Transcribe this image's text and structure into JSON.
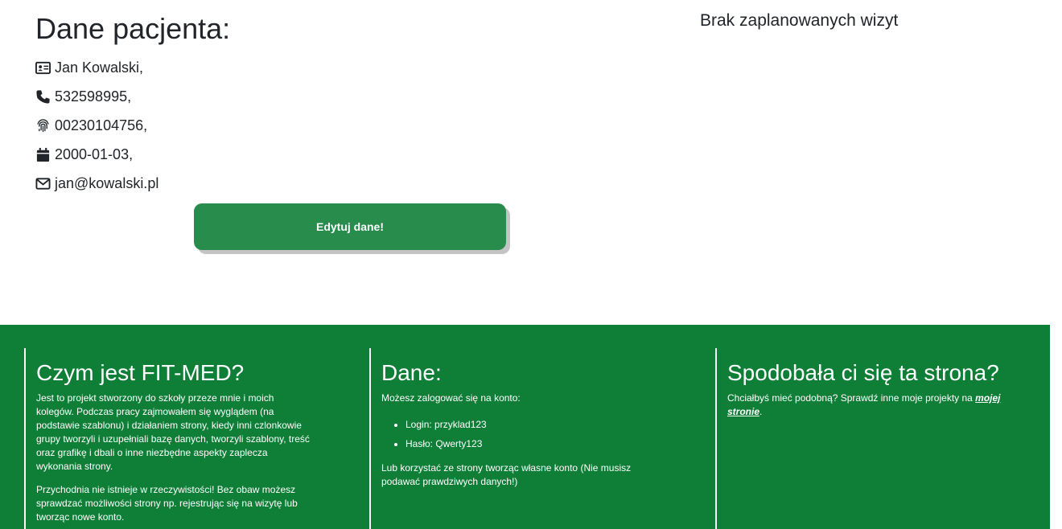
{
  "patient": {
    "heading": "Dane pacjenta:",
    "name": "Jan Kowalski,",
    "phone": "532598995,",
    "pesel": "00230104756,",
    "birth_date": "2000-01-03,",
    "email": "jan@kowalski.pl",
    "edit_button": "Edytuj dane!",
    "icons": [
      "id-card-icon",
      "phone-icon",
      "fingerprint-icon",
      "calendar-icon",
      "envelope-icon"
    ]
  },
  "visits": {
    "empty_text": "Brak zaplanowanych wizyt"
  },
  "footer": {
    "background": "#0f7e37",
    "about": {
      "title": "Czym jest FIT-MED?",
      "p1": "Jest to projekt stworzony do szkoły przeze mnie i moich kolegów. Podczas pracy zajmowałem się wyglądem (na podstawie szablonu) i działaniem strony, kiedy inni czlonkowie grupy tworzyli i uzupełniali bazę danych, tworzyli szablony, treść oraz grafikę i dbali o inne niezbędne aspekty zaplecza wykonania strony.",
      "p2": "Przychodnia nie istnieje w rzeczywistości! Bez obaw możesz sprawdzać możliwości strony np. rejestrując się na wizytę lub tworząc nowe konto."
    },
    "data": {
      "title": "Dane:",
      "intro": "Możesz zalogować się na konto:",
      "login": "Login: przyklad123",
      "password": "Hasło: Qwerty123",
      "note": "Lub korzystać ze strony tworząc własne konto (Nie musisz podawać prawdziwych danych!)"
    },
    "like": {
      "title": "Spodobała ci się ta strona?",
      "text": "Chciałbyś mieć podobną? Sprawdź inne moje projekty na ",
      "link": "mojej stronie",
      "end": "."
    }
  }
}
